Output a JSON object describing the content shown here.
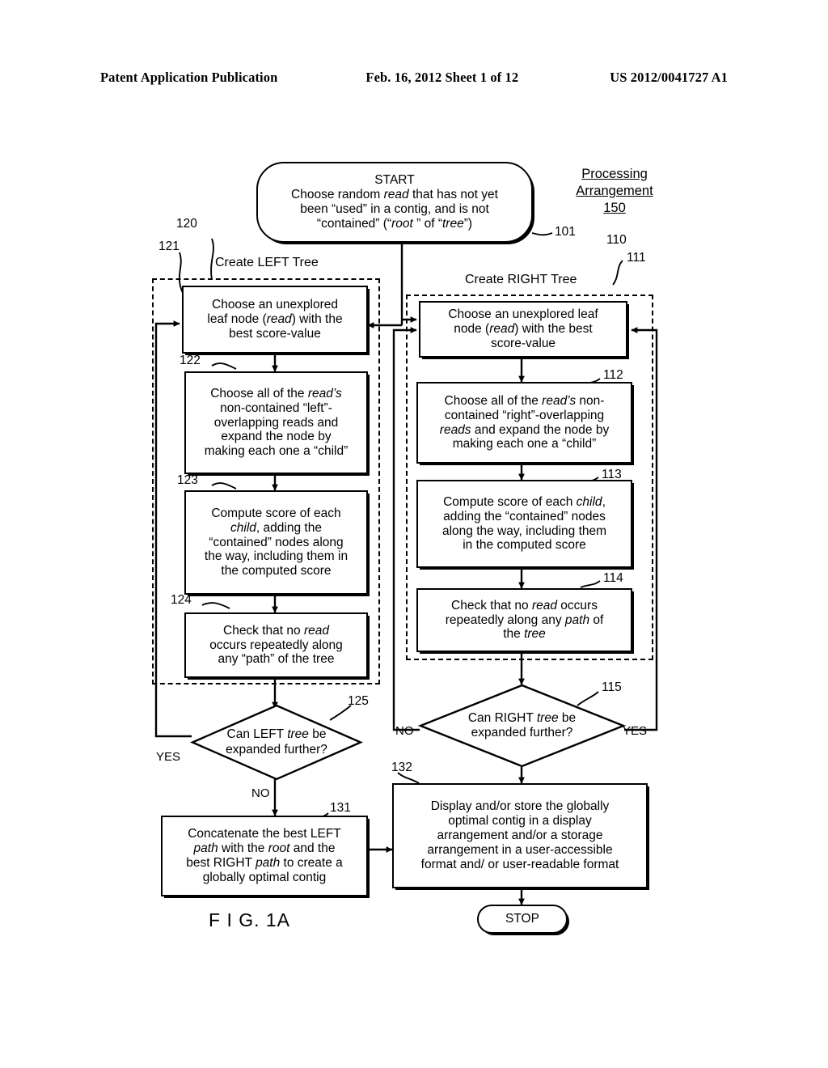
{
  "header": {
    "left": "Patent Application Publication",
    "middle": "Feb. 16, 2012  Sheet 1 of 12",
    "right": "US 2012/0041727 A1"
  },
  "unit": {
    "line1": "Processing",
    "line2": "Arrangement",
    "line3": "150"
  },
  "figure_label": "F I G. 1A",
  "groups": {
    "left": {
      "title": "Create LEFT Tree",
      "ref": "120"
    },
    "right": {
      "title": "Create RIGHT Tree",
      "ref": "110"
    }
  },
  "nodes": {
    "start": {
      "ref": "101",
      "line1": "START",
      "line2_a": "Choose random ",
      "line2_i": "read",
      "line2_b": " that has not yet",
      "line3": "been “used” in a contig, and is not",
      "line4_a": "“contained” (“",
      "line4_i": "root",
      "line4_b": " ” of “",
      "line4_i2": "tree",
      "line4_c": "”)"
    },
    "n121": {
      "ref": "121",
      "line1": "Choose an unexplored",
      "line2_a": "leaf node (",
      "line2_i": "read",
      "line2_b": ") with the",
      "line3": "best score-value"
    },
    "n122": {
      "ref": "122",
      "line1_a": "Choose all of the ",
      "line1_i": "read’s",
      "line2": "non-contained “left”-",
      "line3": "overlapping reads and",
      "line4": "expand the node by",
      "line5": "making each one a “child”"
    },
    "n123": {
      "ref": "123",
      "line1": "Compute score of each",
      "line2_i": "child",
      "line2_b": ", adding the",
      "line3": "“contained” nodes along",
      "line4": "the way, including them in",
      "line5": "the computed score"
    },
    "n124": {
      "ref": "124",
      "line1_a": "Check that no ",
      "line1_i": "read",
      "line2": "occurs repeatedly along",
      "line3": "any “path” of the tree"
    },
    "n111": {
      "ref": "111",
      "line1": "Choose an unexplored leaf",
      "line2_a": "node (",
      "line2_i": "read",
      "line2_b": ") with the best",
      "line3": "score-value"
    },
    "n112": {
      "ref": "112",
      "line1_a": "Choose all of the ",
      "line1_i": "read’s",
      "line1_b": " non-",
      "line2": "contained “right”-overlapping",
      "line3_i": "reads",
      "line3_b": " and expand the node by",
      "line4": "making each one a “child”"
    },
    "n113": {
      "ref": "113",
      "line1_a": "Compute score of each ",
      "line1_i": "child",
      "line1_b": ",",
      "line2": "adding the “contained” nodes",
      "line3": "along the way, including them",
      "line4": "in the computed score"
    },
    "n114": {
      "ref": "114",
      "line1_a": "Check that no ",
      "line1_i": "read",
      "line1_b": " occurs",
      "line2_a": "repeatedly along any ",
      "line2_i": "path",
      "line2_b": " of",
      "line3_a": "the ",
      "line3_i": "tree"
    },
    "d125": {
      "ref": "125",
      "line1_a": "Can LEFT ",
      "line1_i": "tree",
      "line1_b": " be",
      "line2": "expanded further?",
      "yes": "YES",
      "no": "NO"
    },
    "d115": {
      "ref": "115",
      "line1_a": "Can RIGHT ",
      "line1_i": "tree",
      "line1_b": " be",
      "line2": "expanded further?",
      "yes": "YES",
      "no": "NO"
    },
    "n131": {
      "ref": "131",
      "line1": "Concatenate the best LEFT",
      "line2_i": "path",
      "line2_a": " with the ",
      "line2_i2": "root",
      "line2_b": " and the",
      "line3_a": "best RIGHT ",
      "line3_i": "path",
      "line3_b": " to create a",
      "line4": "globally optimal contig"
    },
    "n132": {
      "ref": "132",
      "line1": "Display and/or store the globally",
      "line2": "optimal contig in a display",
      "line3": "arrangement and/or a storage",
      "line4": "arrangement in a user-accessible",
      "line5": "format and/ or user-readable format"
    },
    "stop": {
      "label": "STOP"
    }
  },
  "colors": {
    "ink": "#000000",
    "paper": "#ffffff"
  }
}
